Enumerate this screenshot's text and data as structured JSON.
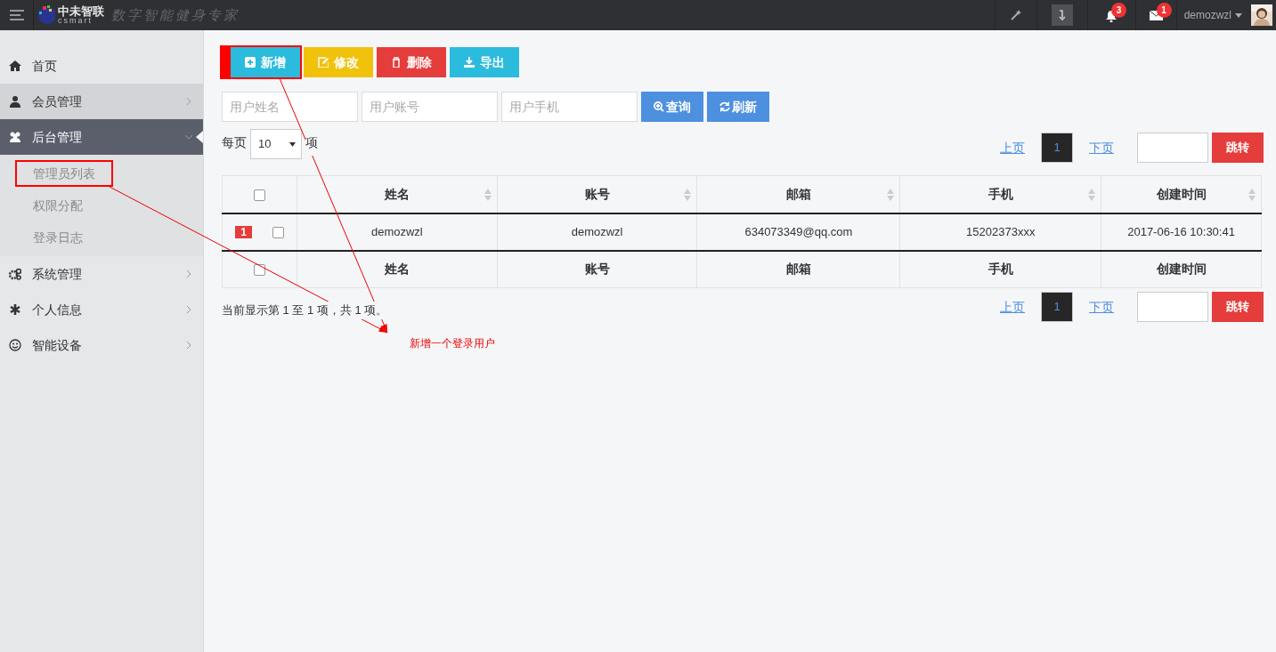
{
  "topbar": {
    "logo_name": "中未智联",
    "logo_sub": "csmart",
    "slogan": "数字智能健身专家",
    "notifications": "3",
    "messages": "1",
    "user": "demozwzl"
  },
  "sidebar": {
    "items": [
      {
        "label": "首页",
        "selected": false,
        "hovered": false
      },
      {
        "label": "会员管理",
        "selected": false,
        "hovered": true,
        "expanded": false
      },
      {
        "label": "后台管理",
        "selected": true,
        "hovered": false,
        "expanded": true,
        "children": [
          {
            "label": "管理员列表",
            "annotated": true
          },
          {
            "label": "权限分配",
            "annotated": false
          },
          {
            "label": "登录日志",
            "annotated": false
          }
        ]
      },
      {
        "label": "系统管理",
        "selected": false,
        "hovered": false,
        "expanded": false
      },
      {
        "label": "个人信息",
        "selected": false,
        "hovered": false,
        "expanded": false
      },
      {
        "label": "智能设备",
        "selected": false,
        "hovered": false,
        "expanded": false
      }
    ]
  },
  "toolbar": [
    {
      "kind": "add",
      "label": "新增",
      "annotated": true
    },
    {
      "kind": "edit",
      "label": "修改",
      "annotated": false
    },
    {
      "kind": "delete",
      "label": "删除",
      "annotated": false
    },
    {
      "kind": "export",
      "label": "导出",
      "annotated": false
    }
  ],
  "search": {
    "fields": [
      {
        "placeholder": "用户姓名"
      },
      {
        "placeholder": "用户账号"
      },
      {
        "placeholder": "用户手机"
      }
    ],
    "buttons": [
      {
        "kind": "query",
        "label": "查询"
      },
      {
        "kind": "refresh",
        "label": "刷新"
      }
    ]
  },
  "page_size": {
    "before": "每页",
    "value": "10",
    "after": "项"
  },
  "pagination_top": {
    "prev": "上页",
    "page": "1",
    "next": "下页",
    "jump": "跳转"
  },
  "table": {
    "header_checked": false,
    "columns": [
      "姓名",
      "账号",
      "邮箱",
      "手机",
      "创建时间"
    ],
    "rows": [
      {
        "number": "1",
        "checked": false,
        "cells": [
          "demozwzl",
          "demozwzl",
          "634073349@qq.com",
          "15202373xxx",
          "2017-06-16 10:30:41"
        ]
      }
    ],
    "footer_checked": false,
    "footer": [
      "姓名",
      "账号",
      "邮箱",
      "手机",
      "创建时间"
    ]
  },
  "summary": "当前显示第 1 至 1 项，共 1 项。",
  "pagination_bottom": {
    "prev": "上页",
    "page": "1",
    "next": "下页",
    "jump": "跳转"
  },
  "annotation": "新增一个登录用户"
}
